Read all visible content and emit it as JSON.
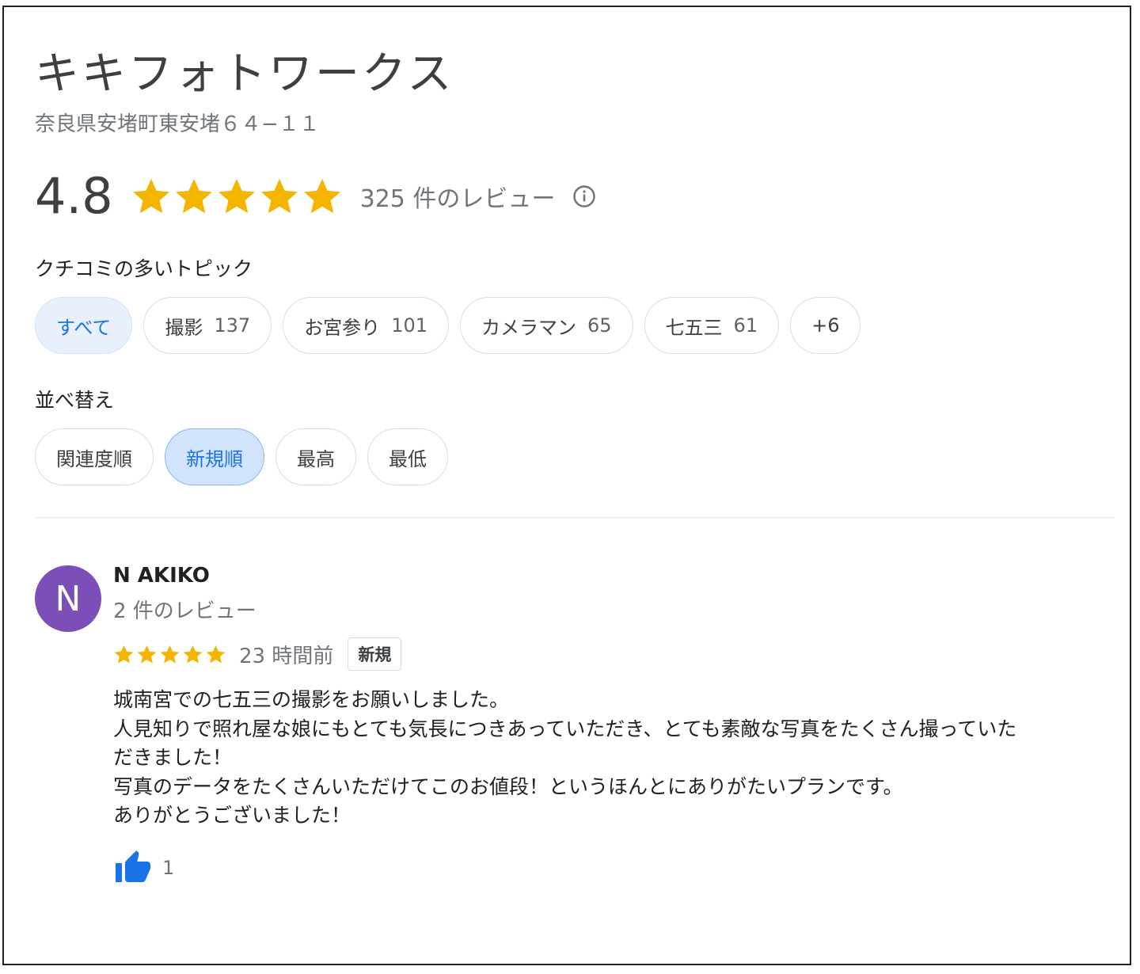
{
  "business": {
    "name": "キキフォトワークス",
    "address": "奈良県安堵町東安堵６４−１１",
    "rating": "4.8",
    "review_count_label": "325 件のレビュー"
  },
  "topics": {
    "heading": "クチコミの多いトピック",
    "chips": [
      {
        "label": "すべて",
        "count": ""
      },
      {
        "label": "撮影",
        "count": "137"
      },
      {
        "label": "お宮参り",
        "count": "101"
      },
      {
        "label": "カメラマン",
        "count": "65"
      },
      {
        "label": "七五三",
        "count": "61"
      },
      {
        "label": "+6",
        "count": ""
      }
    ]
  },
  "sort": {
    "heading": "並べ替え",
    "options": [
      "関連度順",
      "新規順",
      "最高",
      "最低"
    ]
  },
  "review": {
    "avatar_letter": "N",
    "reviewer_name": "N AKIKO",
    "reviewer_meta": "2 件のレビュー",
    "time_ago": "23 時間前",
    "badge": "新規",
    "text_lines": [
      "城南宮での七五三の撮影をお願いしました。",
      "人見知りで照れ屋な娘にもとても気長につきあっていただき、とても素敵な写真をたくさん撮っていた",
      "だきました！",
      "写真のデータをたくさんいただけてこのお値段！というほんとにありがたいプランです。",
      "ありがとうございました！"
    ],
    "like_count": "1"
  },
  "colors": {
    "star": "#f4b400",
    "accent_blue": "#1a73e8",
    "avatar_purple": "#7b4eb8"
  },
  "icons": {
    "rating_stars": "star-icon",
    "info": "info-icon",
    "like": "thumbs-up-icon"
  }
}
